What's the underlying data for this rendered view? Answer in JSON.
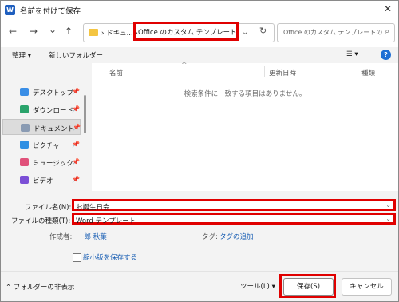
{
  "window": {
    "title": "名前を付けて保存",
    "app_icon": "W",
    "close": "✕"
  },
  "nav": {
    "back": "←",
    "forward": "→",
    "recent": "⌄",
    "up": "↑"
  },
  "address": {
    "sep1": "›",
    "crumb1": "ドキュ...",
    "sep2": "›",
    "current": "Office のカスタム テンプレート",
    "dropdown": "⌄",
    "refresh": "↻"
  },
  "search": {
    "placeholder": "Office のカスタム テンプレートの...",
    "icon": "⌕"
  },
  "toolbar": {
    "organize": "整理 ▾",
    "new_folder": "新しいフォルダー",
    "view": "☰ ▾",
    "help": "?"
  },
  "sidebar": {
    "items": [
      {
        "label": "デスクトップ",
        "icon": "desktop-icon",
        "color": "#3a8ee6"
      },
      {
        "label": "ダウンロード",
        "icon": "download-icon",
        "color": "#2aa36b"
      },
      {
        "label": "ドキュメント",
        "icon": "documents-icon",
        "color": "#8a9bb3"
      },
      {
        "label": "ピクチャ",
        "icon": "pictures-icon",
        "color": "#2f8fe3"
      },
      {
        "label": "ミュージック",
        "icon": "music-icon",
        "color": "#e0517a"
      },
      {
        "label": "ビデオ",
        "icon": "video-icon",
        "color": "#7b4fd6"
      }
    ],
    "pin": "📌"
  },
  "filelist": {
    "columns": [
      "名前",
      "更新日時",
      "種類"
    ],
    "sort_indicator": "^",
    "empty_message": "検索条件に一致する項目はありません。"
  },
  "form": {
    "filename_label": "ファイル名(N):",
    "filename_value": "お誕生日会",
    "filetype_label": "ファイルの種類(T):",
    "filetype_value": "Word テンプレート",
    "author_label": "作成者:",
    "author_value": "一郎 秋葉",
    "tags_label": "タグ:",
    "tags_value": "タグの追加",
    "thumbnail_label": "縮小版を保存する"
  },
  "footer": {
    "hide_folders": "⌃ フォルダーの非表示",
    "tools": "ツール(L)  ▾",
    "save": "保存(S)",
    "cancel": "キャンセル"
  },
  "colors": {
    "highlight": "#e00000",
    "link": "#1a5fb4",
    "accent": "#1f6fd4"
  }
}
